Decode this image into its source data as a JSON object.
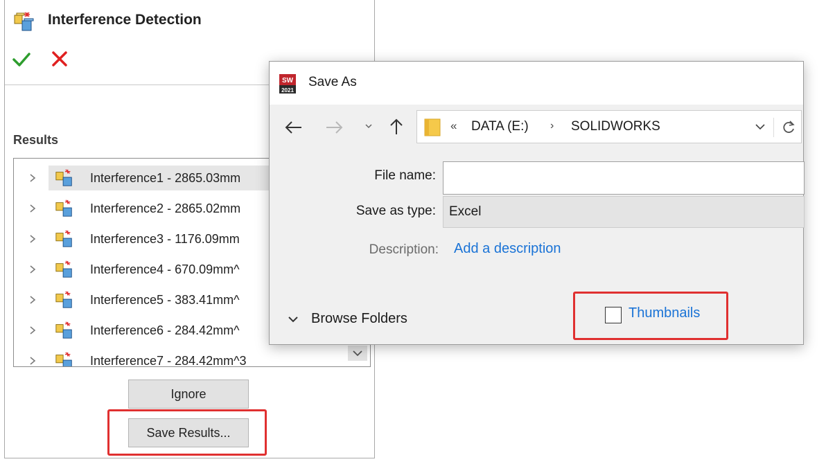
{
  "panel": {
    "title": "Interference Detection",
    "title_icon": "interference-icon",
    "ok_icon": "checkmark-icon",
    "cancel_icon": "x-icon",
    "results_label": "Results",
    "results": [
      {
        "label": "Interference1 - 2865.03mm",
        "selected": true
      },
      {
        "label": "Interference2 - 2865.02mm",
        "selected": false
      },
      {
        "label": "Interference3 - 1176.09mm",
        "selected": false
      },
      {
        "label": "Interference4 - 670.09mm^",
        "selected": false
      },
      {
        "label": "Interference5 - 383.41mm^",
        "selected": false
      },
      {
        "label": "Interference6 - 284.42mm^",
        "selected": false
      },
      {
        "label": "Interference7 - 284.42mm^3",
        "selected": false
      }
    ],
    "ignore_label": "Ignore",
    "save_results_label": "Save Results..."
  },
  "dialog": {
    "title": "Save As",
    "app_icon": "solidworks-2021-icon",
    "address": {
      "overflow": "«",
      "crumbs": [
        "DATA (E:)",
        "SOLIDWORKS"
      ],
      "separator": "›"
    },
    "file_name_label": "File name:",
    "file_name_value": "",
    "save_as_type_label": "Save as type:",
    "save_as_type_value": "Excel",
    "description_label": "Description:",
    "description_link": "Add a description",
    "browse_folders_label": "Browse Folders",
    "thumbnails_label": "Thumbnails",
    "thumbnails_checked": false
  },
  "colors": {
    "highlight": "#e03030",
    "link": "#1a73d6",
    "ok": "#2e9d2e",
    "cancel": "#e02020"
  }
}
